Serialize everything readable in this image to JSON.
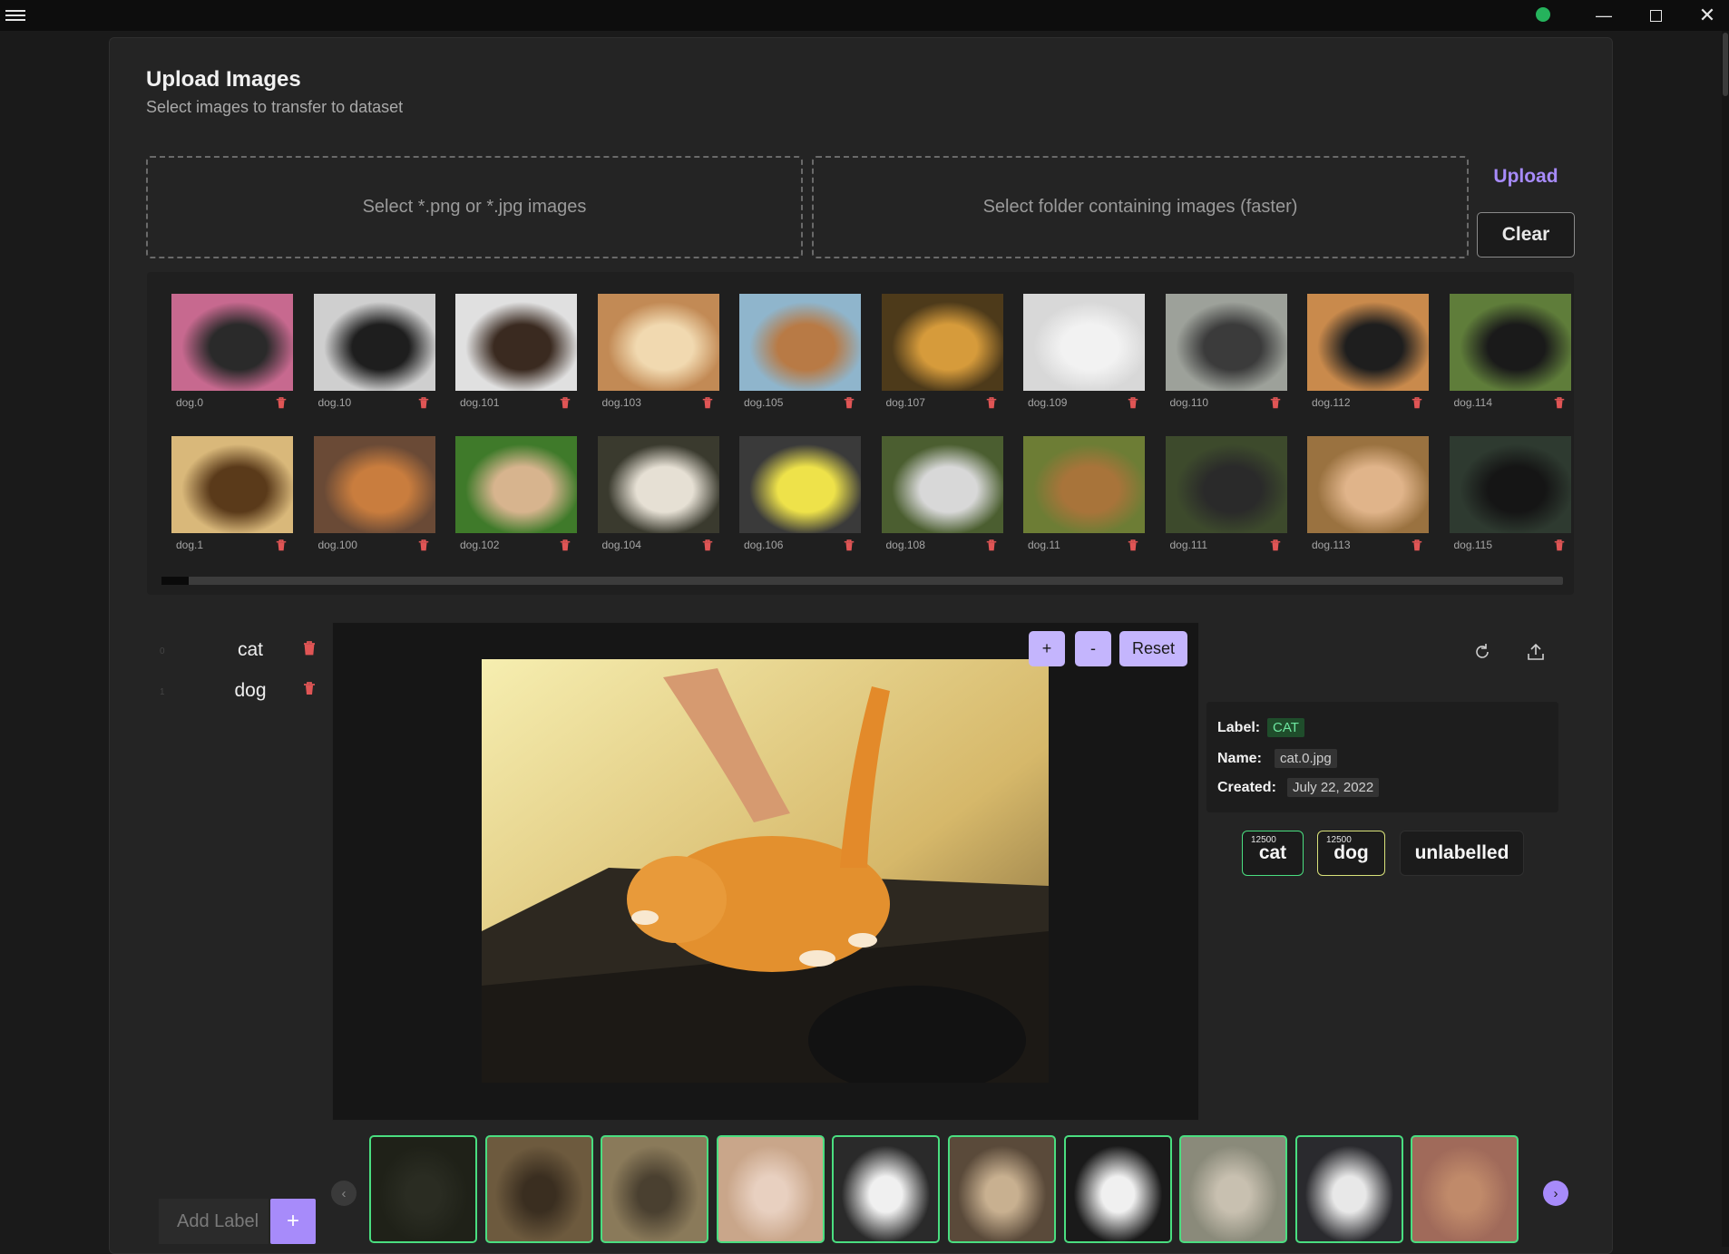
{
  "window": {
    "menu_icon": "hamburger-icon",
    "status_color": "#25b35c",
    "min_icon": "minimize-icon",
    "max_icon": "maximize-icon",
    "close_icon": "close-icon",
    "close_glyph": "✕",
    "min_glyph": "—"
  },
  "header": {
    "title": "Upload Images",
    "subtitle": "Select images to transfer to dataset"
  },
  "upload": {
    "files_prompt": "Select *.png or *.jpg images",
    "folder_prompt": "Select folder containing images (faster)",
    "upload_label": "Upload",
    "clear_label": "Clear"
  },
  "gallery": {
    "row1": [
      "dog.0",
      "dog.10",
      "dog.101",
      "dog.103",
      "dog.105",
      "dog.107",
      "dog.109",
      "dog.110",
      "dog.112",
      "dog.114"
    ],
    "row2": [
      "dog.1",
      "dog.100",
      "dog.102",
      "dog.104",
      "dog.106",
      "dog.108",
      "dog.11",
      "dog.111",
      "dog.113",
      "dog.115"
    ],
    "delete_icon": "trash-icon"
  },
  "labels": {
    "items": [
      {
        "index": "0",
        "name": "cat"
      },
      {
        "index": "1",
        "name": "dog"
      }
    ],
    "add_placeholder": "Add Label",
    "add_button": "+"
  },
  "viewer": {
    "zoom_in": "+",
    "zoom_out": "-",
    "reset": "Reset",
    "rotate_icon": "rotate-icon",
    "export_icon": "export-icon"
  },
  "info": {
    "label_key": "Label:",
    "label_value": "CAT",
    "name_key": "Name:",
    "name_value": "cat.0.jpg",
    "created_key": "Created:",
    "created_value": "July 22, 2022"
  },
  "counts": [
    {
      "count": "12500",
      "name": "cat"
    },
    {
      "count": "12500",
      "name": "dog"
    },
    {
      "count": "",
      "name": "unlabelled"
    }
  ],
  "filmstrip": {
    "prev": "‹",
    "next": "›"
  },
  "colors": {
    "accent": "#a78bfa",
    "labeled_border": "#4ade80",
    "delete": "#e05555",
    "background": "#1a1a1a",
    "card": "#242424"
  }
}
